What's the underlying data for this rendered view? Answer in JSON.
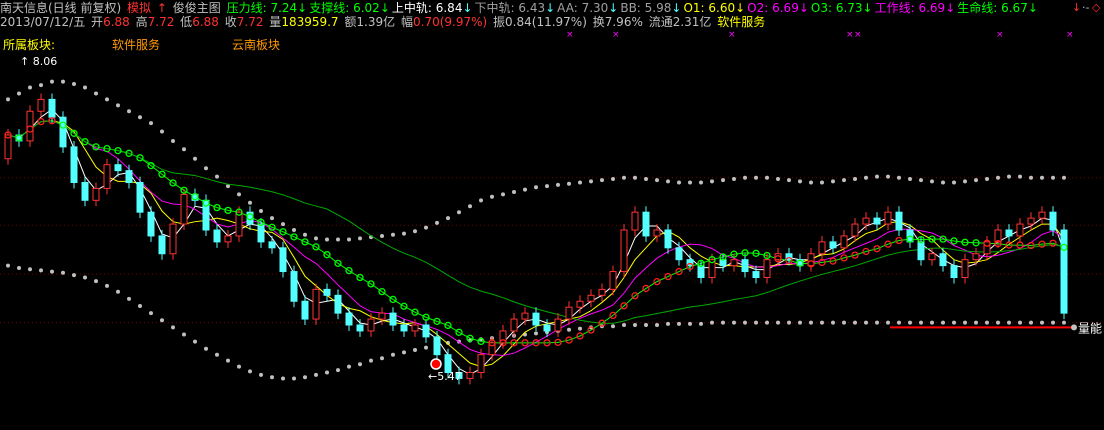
{
  "header": {
    "stock_title": "南天信息(日线 前复权)",
    "sim_label": "模拟",
    "main_label": "俊俊主图",
    "lines": [
      {
        "label": "压力线",
        "value": "7.24",
        "color": "#00ff00",
        "arrow": "↓"
      },
      {
        "label": "支撑线",
        "value": "6.02",
        "color": "#00ff00",
        "arrow": "↓"
      },
      {
        "label": "上中轨",
        "value": "6.84",
        "color": "#ffffff",
        "arrow": "↓"
      },
      {
        "label": "下中轨",
        "value": "6.43",
        "color": "#a0a0a0",
        "arrow": "↓"
      },
      {
        "label": "AA",
        "value": "7.30",
        "color": "#a0a0a0",
        "arrow": "↓"
      },
      {
        "label": "BB",
        "value": "5.98",
        "color": "#a0a0a0",
        "arrow": "↓"
      },
      {
        "label": "O1",
        "value": "6.60",
        "color": "#ffff00",
        "arrow": "↓"
      },
      {
        "label": "O2",
        "value": "6.69",
        "color": "#ff00ff",
        "arrow": "↓"
      },
      {
        "label": "O3",
        "value": "6.73",
        "color": "#00ff00",
        "arrow": "↓"
      },
      {
        "label": "工作线",
        "value": "6.69",
        "color": "#ff00ff",
        "arrow": "↓"
      },
      {
        "label": "生命线",
        "value": "6.67",
        "color": "#00ff00",
        "arrow": "↓"
      }
    ],
    "ellipsis": "·-",
    "quote": {
      "date": "2013/07/12/五",
      "open_label": "开",
      "open": "6.88",
      "high_label": "高",
      "high": "7.72",
      "low_label": "低",
      "low": "6.88",
      "close_label": "收",
      "close": "7.72",
      "vol_label": "量",
      "vol": "183959.7",
      "amount_label": "额",
      "amount": "1.39亿",
      "change_label": "幅",
      "change": "0.70(9.97%)",
      "amp_label": "振",
      "amp": "0.84(11.97%)",
      "turnover_label": "换",
      "turnover": "7.96%",
      "float_label": "流通",
      "float": "2.31亿",
      "sector": "软件服务"
    }
  },
  "sectors": {
    "label": "所属板块:",
    "items": [
      "软件服务",
      "云南板块"
    ]
  },
  "colors": {
    "up": "#ff3232",
    "down": "#54ffff",
    "green": "#00ff00",
    "yellow": "#ffff00",
    "magenta": "#ff00ff",
    "band": "#c0c0c0",
    "supply": "#ff0000"
  },
  "chart_data": {
    "type": "candlestick",
    "price_annotations": {
      "high": "8.06",
      "low": "5.47"
    },
    "right_label": "量能",
    "arrow_up_label": "↑",
    "arrow_left_label": "←",
    "candles_open": [
      7.4,
      7.6,
      7.55,
      7.8,
      7.9,
      7.75,
      7.5,
      7.2,
      7.05,
      7.15,
      7.35,
      7.3,
      7.2,
      6.95,
      6.75,
      6.6,
      6.85,
      7.1,
      7.05,
      6.8,
      6.7,
      6.75,
      6.95,
      6.85,
      6.7,
      6.65,
      6.45,
      6.2,
      6.05,
      6.3,
      6.25,
      6.1,
      6.0,
      5.95,
      6.05,
      6.1,
      6.0,
      5.95,
      6.0,
      5.9,
      5.75,
      5.6,
      5.55,
      5.6,
      5.75,
      5.85,
      5.95,
      6.05,
      6.1,
      6.0,
      5.95,
      6.05,
      6.15,
      6.2,
      6.25,
      6.3,
      6.45,
      6.8,
      6.95,
      6.75,
      6.8,
      6.65,
      6.55,
      6.5,
      6.4,
      6.55,
      6.5,
      6.55,
      6.45,
      6.4,
      6.55,
      6.6,
      6.55,
      6.5,
      6.6,
      6.7,
      6.65,
      6.75,
      6.85,
      6.9,
      6.85,
      6.95,
      6.8,
      6.7,
      6.55,
      6.6,
      6.5,
      6.4,
      6.55,
      6.6,
      6.7,
      6.8,
      6.75,
      6.85,
      6.9,
      6.95,
      6.8
    ],
    "candles_close": [
      7.6,
      7.55,
      7.8,
      7.9,
      7.75,
      7.5,
      7.2,
      7.05,
      7.15,
      7.35,
      7.3,
      7.2,
      6.95,
      6.75,
      6.6,
      6.85,
      7.1,
      7.05,
      6.8,
      6.7,
      6.75,
      6.95,
      6.85,
      6.7,
      6.65,
      6.45,
      6.2,
      6.05,
      6.3,
      6.25,
      6.1,
      6.0,
      5.95,
      6.05,
      6.1,
      6.0,
      5.95,
      6.0,
      5.9,
      5.75,
      5.6,
      5.55,
      5.6,
      5.75,
      5.85,
      5.95,
      6.05,
      6.1,
      6.0,
      5.95,
      6.05,
      6.15,
      6.2,
      6.25,
      6.3,
      6.45,
      6.8,
      6.95,
      6.75,
      6.8,
      6.65,
      6.55,
      6.5,
      6.4,
      6.55,
      6.5,
      6.55,
      6.45,
      6.4,
      6.55,
      6.6,
      6.55,
      6.5,
      6.6,
      6.7,
      6.65,
      6.75,
      6.85,
      6.9,
      6.85,
      6.95,
      6.8,
      6.7,
      6.55,
      6.6,
      6.5,
      6.4,
      6.55,
      6.6,
      6.7,
      6.8,
      6.75,
      6.85,
      6.9,
      6.95,
      6.8,
      6.1
    ],
    "ylim": [
      5.2,
      8.4
    ],
    "upper_band": [
      7.9,
      7.95,
      8.0,
      8.02,
      8.05,
      8.05,
      8.03,
      8.0,
      7.95,
      7.9,
      7.85,
      7.8,
      7.75,
      7.7,
      7.63,
      7.55,
      7.48,
      7.4,
      7.32,
      7.25,
      7.17,
      7.1,
      7.03,
      6.96,
      6.9,
      6.85,
      6.8,
      6.76,
      6.73,
      6.72,
      6.72,
      6.72,
      6.73,
      6.74,
      6.75,
      6.76,
      6.77,
      6.79,
      6.82,
      6.86,
      6.9,
      6.95,
      7.0,
      7.05,
      7.08,
      7.1,
      7.12,
      7.14,
      7.16,
      7.17,
      7.18,
      7.19,
      7.2,
      7.21,
      7.22,
      7.23,
      7.24,
      7.24,
      7.23,
      7.22,
      7.21,
      7.2,
      7.2,
      7.2,
      7.21,
      7.22,
      7.23,
      7.24,
      7.24,
      7.24,
      7.23,
      7.22,
      7.21,
      7.2,
      7.2,
      7.21,
      7.22,
      7.23,
      7.24,
      7.25,
      7.25,
      7.24,
      7.23,
      7.22,
      7.21,
      7.2,
      7.2,
      7.21,
      7.22,
      7.23,
      7.24,
      7.25,
      7.25,
      7.24,
      7.24,
      7.24,
      7.24
    ],
    "lower_band": [
      6.5,
      6.48,
      6.47,
      6.46,
      6.45,
      6.44,
      6.42,
      6.4,
      6.37,
      6.33,
      6.28,
      6.22,
      6.16,
      6.1,
      6.04,
      5.98,
      5.92,
      5.86,
      5.8,
      5.75,
      5.7,
      5.65,
      5.61,
      5.58,
      5.56,
      5.55,
      5.55,
      5.56,
      5.58,
      5.6,
      5.62,
      5.65,
      5.67,
      5.7,
      5.72,
      5.75,
      5.77,
      5.79,
      5.81,
      5.83,
      5.85,
      5.86,
      5.87,
      5.88,
      5.89,
      5.9,
      5.91,
      5.92,
      5.93,
      5.94,
      5.95,
      5.96,
      5.97,
      5.98,
      5.99,
      5.99,
      6.0,
      6.0,
      6.0,
      6.0,
      6.01,
      6.01,
      6.01,
      6.01,
      6.02,
      6.02,
      6.02,
      6.02,
      6.02,
      6.02,
      6.02,
      6.02,
      6.02,
      6.02,
      6.02,
      6.02,
      6.02,
      6.02,
      6.02,
      6.02,
      6.02,
      6.02,
      6.02,
      6.02,
      6.02,
      6.02,
      6.02,
      6.02,
      6.02,
      6.02,
      6.02,
      6.02,
      6.02,
      6.02,
      6.02,
      6.02,
      6.02
    ],
    "pressure_line": 7.24,
    "support_line": 6.02,
    "mid_upper": 6.84,
    "mid_lower": 6.43,
    "resistance_line_value": 5.98
  }
}
